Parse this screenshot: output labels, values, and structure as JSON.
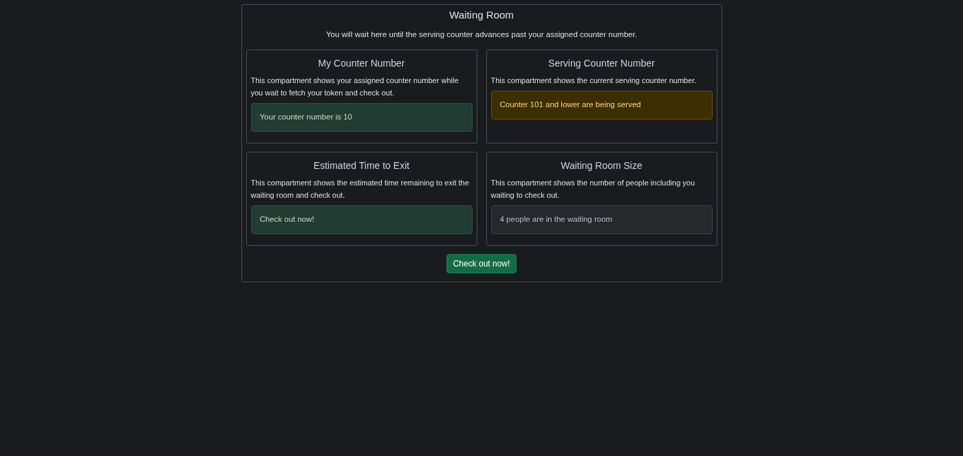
{
  "panel": {
    "title": "Waiting Room",
    "subtitle": "You will wait here until the serving counter advances past your assigned counter number."
  },
  "cards": [
    {
      "title": "My Counter Number",
      "description": "This compartment shows your assigned counter number while you wait to fetch your token and check out.",
      "alert": {
        "kind": "success",
        "text": "Your counter number is 10"
      }
    },
    {
      "title": "Serving Counter Number",
      "description": "This compartment shows the current serving counter number.",
      "alert": {
        "kind": "warning",
        "text": "Counter 101 and lower are being served"
      }
    },
    {
      "title": "Estimated Time to Exit",
      "description": "This compartment shows the estimated time remaining to exit the waiting room and check out.",
      "alert": {
        "kind": "success",
        "text": "Check out now!"
      }
    },
    {
      "title": "Waiting Room Size",
      "description": "This compartment shows the number of people including you waiting to check out.",
      "alert": {
        "kind": "secondary",
        "text": "4 people are in the waiting room"
      }
    }
  ],
  "button": {
    "label": "Check out now!"
  }
}
